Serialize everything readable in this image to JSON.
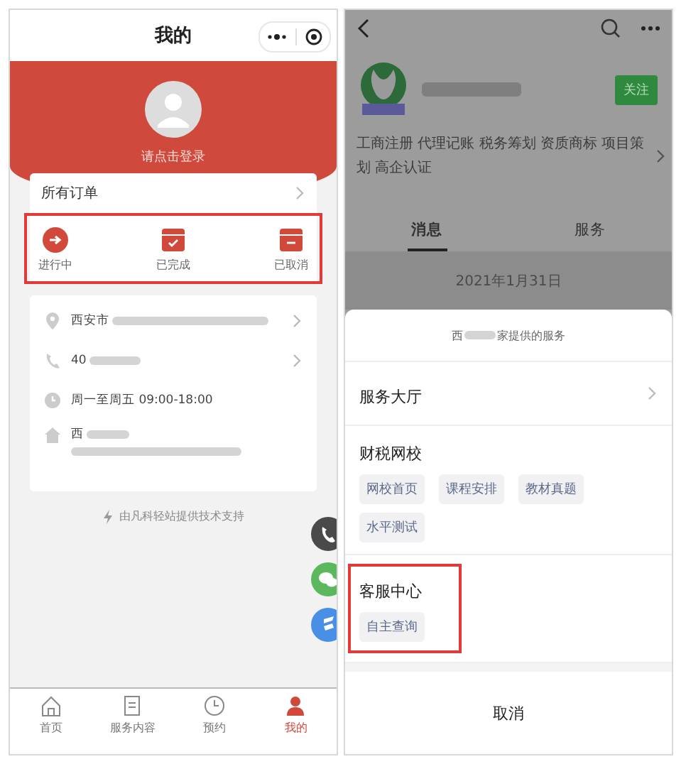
{
  "left": {
    "title": "我的",
    "login_label": "请点击登录",
    "orders": {
      "title": "所有订单",
      "highlighted": true,
      "statuses": [
        {
          "label": "进行中",
          "kind": "progress"
        },
        {
          "label": "已完成",
          "kind": "done"
        },
        {
          "label": "已取消",
          "kind": "cancelled"
        }
      ]
    },
    "info": [
      {
        "kind": "location",
        "text": "西安市",
        "blurred": true,
        "chevron": true
      },
      {
        "kind": "phone",
        "text": "40",
        "blurred": true,
        "chevron": true
      },
      {
        "kind": "hours",
        "text": "周一至周五 09:00-18:00",
        "blurred": false,
        "chevron": false
      },
      {
        "kind": "address",
        "text": "西",
        "blurred": true,
        "chevron": false
      }
    ],
    "support": "由凡科轻站提供技术支持",
    "float_buttons": [
      {
        "kind": "phone",
        "color": "#4a4a4a"
      },
      {
        "kind": "chat",
        "color": "#5cb85c"
      },
      {
        "kind": "brand",
        "color": "#4a8fe6"
      }
    ],
    "tabbar": [
      {
        "label": "首页",
        "kind": "home",
        "selected": false
      },
      {
        "label": "服务内容",
        "kind": "doc",
        "selected": false
      },
      {
        "label": "预约",
        "kind": "clock",
        "selected": false
      },
      {
        "label": "我的",
        "kind": "person",
        "selected": true
      }
    ]
  },
  "right": {
    "follow": "关注",
    "description": "工商注册 代理记账 税务筹划 资质商标 项目策划 高企认证",
    "tabs": [
      {
        "label": "消息",
        "selected": true
      },
      {
        "label": "服务",
        "selected": false
      }
    ],
    "date": "2021年1月31日",
    "sheet": {
      "title_start": "西",
      "title_end": "家提供的服务",
      "cancel": "取消",
      "sections": [
        {
          "title": "服务大厅",
          "chevron": true,
          "highlighted": false
        },
        {
          "title": "财税网校",
          "chevron": false,
          "highlighted": false,
          "chips": [
            "网校首页",
            "课程安排",
            "教材真题",
            "水平测试"
          ]
        },
        {
          "title": "客服中心",
          "chevron": false,
          "highlighted": true,
          "chips": [
            "自主查询"
          ]
        }
      ]
    }
  }
}
